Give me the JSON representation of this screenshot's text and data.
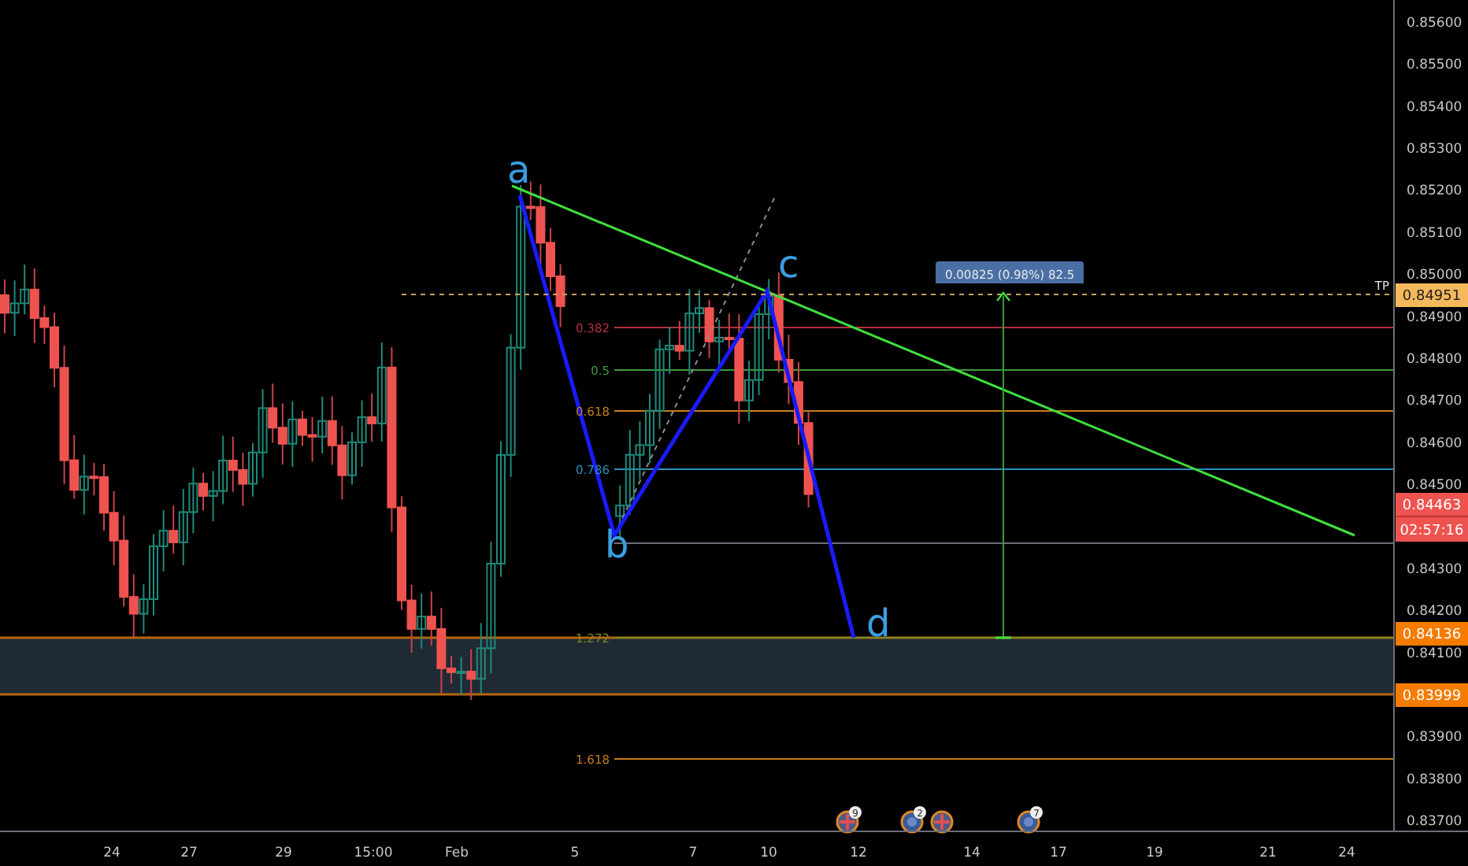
{
  "price_axis": {
    "ticks": [
      "0.85600",
      "0.85500",
      "0.85400",
      "0.85300",
      "0.85200",
      "0.85100",
      "0.85000",
      "0.84900",
      "0.84800",
      "0.84700",
      "0.84600",
      "0.84500",
      "0.84300",
      "0.84200",
      "0.84100",
      "0.83900",
      "0.83800",
      "0.83700"
    ]
  },
  "time_axis": {
    "labels": [
      "24",
      "27",
      "29",
      "15:00",
      "Feb",
      "5",
      "7",
      "10",
      "12",
      "14",
      "17",
      "19",
      "21",
      "24"
    ]
  },
  "price_tags": [
    {
      "kind": "target",
      "value": "0.84951",
      "color": "#f5b85b"
    },
    {
      "kind": "last",
      "value": "0.84463",
      "countdown": "02:57:16",
      "color": "#ef5350"
    },
    {
      "kind": "level",
      "value": "0.84136",
      "color": "#f57c00"
    },
    {
      "kind": "level",
      "value": "0.83999",
      "color": "#f57c00"
    }
  ],
  "pattern_points": [
    "a",
    "b",
    "c",
    "d"
  ],
  "fib_levels": [
    {
      "label": "0.382",
      "color": "#b2303a"
    },
    {
      "label": "0.5",
      "color": "#3c9a3c"
    },
    {
      "label": "0.618",
      "color": "#c77d18"
    },
    {
      "label": "0.786",
      "color": "#2a8fbd"
    },
    {
      "label": "1.272",
      "color": "#7b8a2a"
    },
    {
      "label": "1.618",
      "color": "#c77d18"
    }
  ],
  "target_line": {
    "label": "TP"
  },
  "measure": {
    "label": "0.00825 (0.98%) 82.5"
  },
  "events": [
    {
      "kind": "flag",
      "count": "9"
    },
    {
      "kind": "globe",
      "count": "2"
    },
    {
      "kind": "flag"
    },
    {
      "kind": "globe",
      "count": "7"
    }
  ]
}
